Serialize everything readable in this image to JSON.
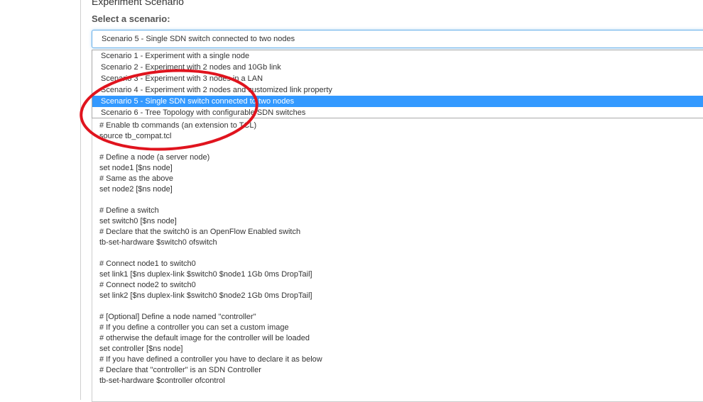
{
  "section_title": "Experiment Scenario",
  "select_label": "Select a scenario:",
  "selected_value": "Scenario 5 - Single SDN switch connected to two nodes",
  "options": [
    "Scenario 1 - Experiment with a single node",
    "Scenario 2 - Experiment with 2 nodes and 10Gb link",
    "Scenario 3 - Experiment with 3 nodes in a LAN",
    "Scenario 4 - Experiment with 2 nodes and customized link property",
    "Scenario 5 - Single SDN switch connected to two nodes",
    "Scenario 6 - Tree Topology with configurable SDN switches"
  ],
  "selected_index": 4,
  "code_lines": [
    "# Enable tb commands (an extension to TCL)",
    "source tb_compat.tcl",
    "",
    "# Define a node (a server node)",
    "set node1 [$ns node]",
    "# Same as the above",
    "set node2 [$ns node]",
    "",
    "# Define a switch",
    "set switch0 [$ns node]",
    "# Declare that the switch0 is an OpenFlow Enabled switch",
    "tb-set-hardware $switch0 ofswitch",
    "",
    "# Connect node1 to switch0",
    "set link1 [$ns duplex-link $switch0 $node1 1Gb 0ms DropTail]",
    "# Connect node2 to switch0",
    "set link2 [$ns duplex-link $switch0 $node2 1Gb 0ms DropTail]",
    "",
    "# [Optional] Define a node named \"controller\"",
    "# If you define a controller you can set a custom image",
    "# otherwise the default image for the controller will be loaded",
    "set controller [$ns node]",
    "# If you have defined a controller you have to declare it as below",
    "# Declare that \"controller\" is an SDN Controller",
    "tb-set-hardware $controller ofcontrol"
  ],
  "annotation_color": "#e0141e"
}
